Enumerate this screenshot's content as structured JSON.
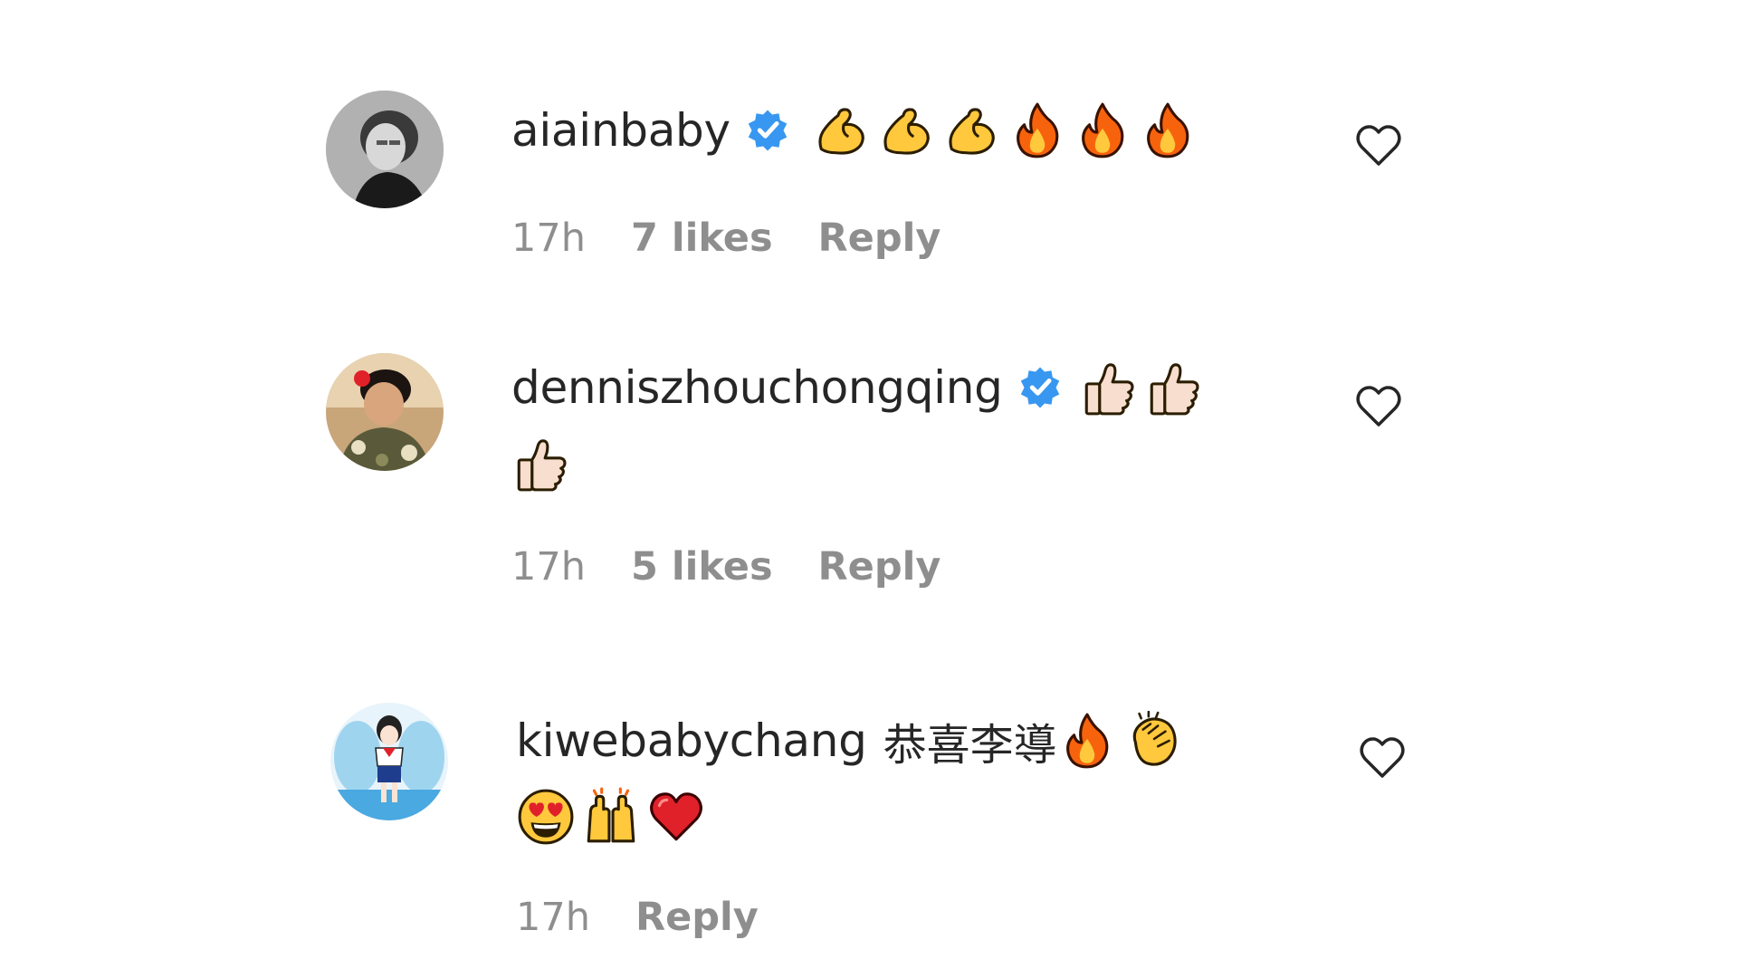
{
  "comments": [
    {
      "username": "aiainbaby",
      "verified": true,
      "text": "",
      "emojis": [
        "muscle-emoji",
        "muscle-emoji",
        "muscle-emoji",
        "fire-emoji",
        "fire-emoji",
        "fire-emoji"
      ],
      "time": "17h",
      "likes": "7 likes",
      "reply": "Reply"
    },
    {
      "username": "dennisz​houchongqing",
      "verified": true,
      "text": "",
      "emojis": [
        "thumbs-up-emoji",
        "thumbs-up-emoji",
        "thumbs-up-emoji"
      ],
      "time": "17h",
      "likes": "5 likes",
      "reply": "Reply"
    },
    {
      "username": "kiwebabychang",
      "verified": false,
      "text": "恭喜李導",
      "emojis": [
        "fire-emoji",
        "clapping-hands-emoji",
        "heart-eyes-emoji",
        "raising-hands-emoji",
        "red-heart-emoji"
      ],
      "time": "17h",
      "likes": "",
      "reply": "Reply"
    }
  ],
  "icons": {
    "verified": "verified-badge-icon",
    "like": "heart-outline-icon"
  },
  "colors": {
    "text": "#262626",
    "meta": "#8e8e8e",
    "verified_blue": "#3897f0"
  }
}
